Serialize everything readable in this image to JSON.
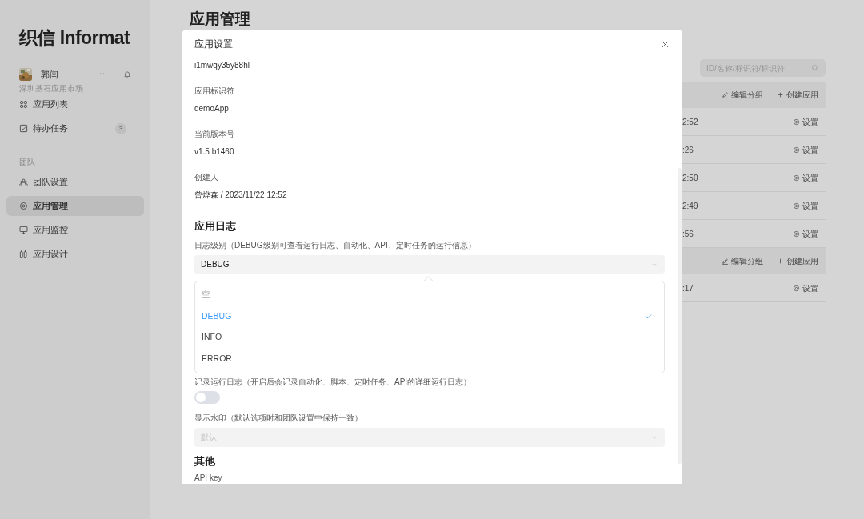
{
  "sidebar": {
    "logo": "织信 Informat",
    "user": {
      "name": "郭闫",
      "org": "深圳基石应用市场"
    },
    "nav": [
      {
        "label": "应用列表",
        "selected": false
      },
      {
        "label": "待办任务",
        "badge": "3",
        "selected": false
      }
    ],
    "section": "团队",
    "team_nav": [
      {
        "label": "团队设置",
        "selected": false
      },
      {
        "label": "应用管理",
        "selected": true
      },
      {
        "label": "应用监控",
        "selected": false
      },
      {
        "label": "应用设计",
        "selected": false
      }
    ]
  },
  "page": {
    "title": "应用管理",
    "search": {
      "placeholder": "ID/名称/标识符/标识符"
    },
    "rows": [
      {
        "kind": "group",
        "actions": [
          "编辑分组",
          "创建应用"
        ]
      },
      {
        "kind": "app",
        "time": "2:52",
        "action": "设置"
      },
      {
        "kind": "app",
        "time": ":26",
        "action": "设置"
      },
      {
        "kind": "app",
        "time": "2:50",
        "action": "设置"
      },
      {
        "kind": "app",
        "time": "2:49",
        "action": "设置"
      },
      {
        "kind": "app",
        "time": ":56",
        "action": "设置"
      },
      {
        "kind": "group",
        "actions": [
          "编辑分组",
          "创建应用"
        ]
      },
      {
        "kind": "app",
        "time": ":17",
        "action": "设置"
      }
    ]
  },
  "modal": {
    "title": "应用设置",
    "fields": [
      {
        "value": "i1mwqy35y88hl"
      },
      {
        "label": "应用标识符",
        "value": "demoApp"
      },
      {
        "label": "当前版本号",
        "value": "v1.5 b1460"
      },
      {
        "label": "创建人",
        "value": "曾烨森 / 2023/11/22 12:52"
      }
    ],
    "log": {
      "heading": "应用日志",
      "level_label": "日志级别（DEBUG级别可查看运行日志、自动化、API、定时任务的运行信息）",
      "level_value": "DEBUG",
      "options": [
        {
          "label": "空",
          "kind": "empty",
          "selected": false
        },
        {
          "label": "DEBUG",
          "kind": "value",
          "selected": true
        },
        {
          "label": "INFO",
          "kind": "value",
          "selected": false
        },
        {
          "label": "ERROR",
          "kind": "value",
          "selected": false
        }
      ],
      "record_label": "记录运行日志（开启后会记录自动化、脚本、定时任务、API的详细运行日志）",
      "record_on": false,
      "watermark_label": "显示水印（默认选项时和团队设置中保持一致）",
      "watermark_placeholder": "默认"
    },
    "other": {
      "heading": "其他",
      "item": "API key"
    }
  }
}
